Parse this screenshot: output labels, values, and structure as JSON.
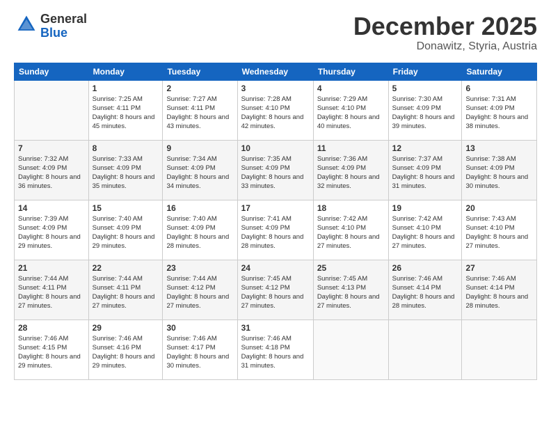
{
  "logo": {
    "general": "General",
    "blue": "Blue"
  },
  "title": {
    "month": "December 2025",
    "location": "Donawitz, Styria, Austria"
  },
  "weekdays": [
    "Sunday",
    "Monday",
    "Tuesday",
    "Wednesday",
    "Thursday",
    "Friday",
    "Saturday"
  ],
  "weeks": [
    [
      {
        "day": "",
        "sunrise": "",
        "sunset": "",
        "daylight": ""
      },
      {
        "day": "1",
        "sunrise": "Sunrise: 7:25 AM",
        "sunset": "Sunset: 4:11 PM",
        "daylight": "Daylight: 8 hours and 45 minutes."
      },
      {
        "day": "2",
        "sunrise": "Sunrise: 7:27 AM",
        "sunset": "Sunset: 4:11 PM",
        "daylight": "Daylight: 8 hours and 43 minutes."
      },
      {
        "day": "3",
        "sunrise": "Sunrise: 7:28 AM",
        "sunset": "Sunset: 4:10 PM",
        "daylight": "Daylight: 8 hours and 42 minutes."
      },
      {
        "day": "4",
        "sunrise": "Sunrise: 7:29 AM",
        "sunset": "Sunset: 4:10 PM",
        "daylight": "Daylight: 8 hours and 40 minutes."
      },
      {
        "day": "5",
        "sunrise": "Sunrise: 7:30 AM",
        "sunset": "Sunset: 4:09 PM",
        "daylight": "Daylight: 8 hours and 39 minutes."
      },
      {
        "day": "6",
        "sunrise": "Sunrise: 7:31 AM",
        "sunset": "Sunset: 4:09 PM",
        "daylight": "Daylight: 8 hours and 38 minutes."
      }
    ],
    [
      {
        "day": "7",
        "sunrise": "Sunrise: 7:32 AM",
        "sunset": "Sunset: 4:09 PM",
        "daylight": "Daylight: 8 hours and 36 minutes."
      },
      {
        "day": "8",
        "sunrise": "Sunrise: 7:33 AM",
        "sunset": "Sunset: 4:09 PM",
        "daylight": "Daylight: 8 hours and 35 minutes."
      },
      {
        "day": "9",
        "sunrise": "Sunrise: 7:34 AM",
        "sunset": "Sunset: 4:09 PM",
        "daylight": "Daylight: 8 hours and 34 minutes."
      },
      {
        "day": "10",
        "sunrise": "Sunrise: 7:35 AM",
        "sunset": "Sunset: 4:09 PM",
        "daylight": "Daylight: 8 hours and 33 minutes."
      },
      {
        "day": "11",
        "sunrise": "Sunrise: 7:36 AM",
        "sunset": "Sunset: 4:09 PM",
        "daylight": "Daylight: 8 hours and 32 minutes."
      },
      {
        "day": "12",
        "sunrise": "Sunrise: 7:37 AM",
        "sunset": "Sunset: 4:09 PM",
        "daylight": "Daylight: 8 hours and 31 minutes."
      },
      {
        "day": "13",
        "sunrise": "Sunrise: 7:38 AM",
        "sunset": "Sunset: 4:09 PM",
        "daylight": "Daylight: 8 hours and 30 minutes."
      }
    ],
    [
      {
        "day": "14",
        "sunrise": "Sunrise: 7:39 AM",
        "sunset": "Sunset: 4:09 PM",
        "daylight": "Daylight: 8 hours and 29 minutes."
      },
      {
        "day": "15",
        "sunrise": "Sunrise: 7:40 AM",
        "sunset": "Sunset: 4:09 PM",
        "daylight": "Daylight: 8 hours and 29 minutes."
      },
      {
        "day": "16",
        "sunrise": "Sunrise: 7:40 AM",
        "sunset": "Sunset: 4:09 PM",
        "daylight": "Daylight: 8 hours and 28 minutes."
      },
      {
        "day": "17",
        "sunrise": "Sunrise: 7:41 AM",
        "sunset": "Sunset: 4:09 PM",
        "daylight": "Daylight: 8 hours and 28 minutes."
      },
      {
        "day": "18",
        "sunrise": "Sunrise: 7:42 AM",
        "sunset": "Sunset: 4:10 PM",
        "daylight": "Daylight: 8 hours and 27 minutes."
      },
      {
        "day": "19",
        "sunrise": "Sunrise: 7:42 AM",
        "sunset": "Sunset: 4:10 PM",
        "daylight": "Daylight: 8 hours and 27 minutes."
      },
      {
        "day": "20",
        "sunrise": "Sunrise: 7:43 AM",
        "sunset": "Sunset: 4:10 PM",
        "daylight": "Daylight: 8 hours and 27 minutes."
      }
    ],
    [
      {
        "day": "21",
        "sunrise": "Sunrise: 7:44 AM",
        "sunset": "Sunset: 4:11 PM",
        "daylight": "Daylight: 8 hours and 27 minutes."
      },
      {
        "day": "22",
        "sunrise": "Sunrise: 7:44 AM",
        "sunset": "Sunset: 4:11 PM",
        "daylight": "Daylight: 8 hours and 27 minutes."
      },
      {
        "day": "23",
        "sunrise": "Sunrise: 7:44 AM",
        "sunset": "Sunset: 4:12 PM",
        "daylight": "Daylight: 8 hours and 27 minutes."
      },
      {
        "day": "24",
        "sunrise": "Sunrise: 7:45 AM",
        "sunset": "Sunset: 4:12 PM",
        "daylight": "Daylight: 8 hours and 27 minutes."
      },
      {
        "day": "25",
        "sunrise": "Sunrise: 7:45 AM",
        "sunset": "Sunset: 4:13 PM",
        "daylight": "Daylight: 8 hours and 27 minutes."
      },
      {
        "day": "26",
        "sunrise": "Sunrise: 7:46 AM",
        "sunset": "Sunset: 4:14 PM",
        "daylight": "Daylight: 8 hours and 28 minutes."
      },
      {
        "day": "27",
        "sunrise": "Sunrise: 7:46 AM",
        "sunset": "Sunset: 4:14 PM",
        "daylight": "Daylight: 8 hours and 28 minutes."
      }
    ],
    [
      {
        "day": "28",
        "sunrise": "Sunrise: 7:46 AM",
        "sunset": "Sunset: 4:15 PM",
        "daylight": "Daylight: 8 hours and 29 minutes."
      },
      {
        "day": "29",
        "sunrise": "Sunrise: 7:46 AM",
        "sunset": "Sunset: 4:16 PM",
        "daylight": "Daylight: 8 hours and 29 minutes."
      },
      {
        "day": "30",
        "sunrise": "Sunrise: 7:46 AM",
        "sunset": "Sunset: 4:17 PM",
        "daylight": "Daylight: 8 hours and 30 minutes."
      },
      {
        "day": "31",
        "sunrise": "Sunrise: 7:46 AM",
        "sunset": "Sunset: 4:18 PM",
        "daylight": "Daylight: 8 hours and 31 minutes."
      },
      {
        "day": "",
        "sunrise": "",
        "sunset": "",
        "daylight": ""
      },
      {
        "day": "",
        "sunrise": "",
        "sunset": "",
        "daylight": ""
      },
      {
        "day": "",
        "sunrise": "",
        "sunset": "",
        "daylight": ""
      }
    ]
  ]
}
